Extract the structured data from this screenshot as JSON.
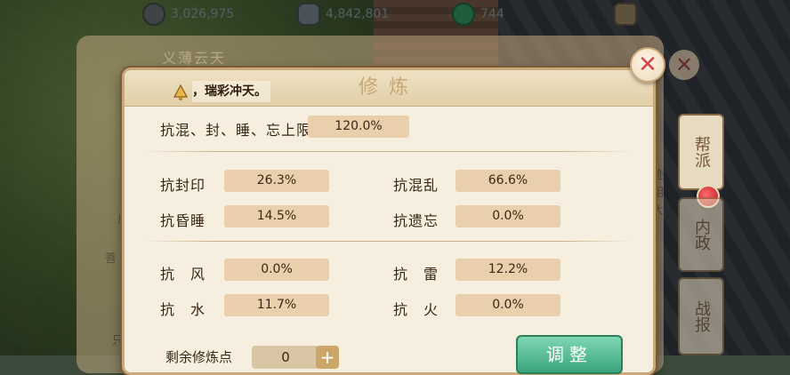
{
  "resources": [
    {
      "icon": "silver-coin-icon",
      "value": "3,026,975"
    },
    {
      "icon": "ingot-icon",
      "value": "4,842,801"
    },
    {
      "icon": "jade-coin-icon",
      "value": "744"
    },
    {
      "icon": "bag-icon",
      "value": ""
    }
  ],
  "background": {
    "panel_title": "义薄云天",
    "side_texts": [
      "庙",
      "菩",
      "只",
      "迹",
      "相",
      "大"
    ]
  },
  "tabs": {
    "help": "帮派",
    "inner": "内政",
    "report": "战报"
  },
  "dialog": {
    "title": "修炼",
    "notice": "，瑞彩冲天。",
    "summary": {
      "label": "抗混、封、睡、忘上限",
      "value": "120.0%"
    },
    "group1": [
      {
        "label": "抗封印",
        "value": "26.3%"
      },
      {
        "label": "抗混乱",
        "value": "66.6%"
      },
      {
        "label": "抗昏睡",
        "value": "14.5%"
      },
      {
        "label": "抗遗忘",
        "value": "0.0%"
      }
    ],
    "group2": [
      {
        "label": "抗　风",
        "value": "0.0%"
      },
      {
        "label": "抗　雷",
        "value": "12.2%"
      },
      {
        "label": "抗　水",
        "value": "11.7%"
      },
      {
        "label": "抗　火",
        "value": "0.0%"
      }
    ],
    "points": {
      "label": "剩余修炼点",
      "value": "0",
      "plus": "+"
    },
    "adjust_label": "调整",
    "close_symbol": "✕"
  },
  "colors": {
    "accent_close": "#d64545",
    "value_box": "#e9cfab",
    "adjust_button": "#3aa67d"
  }
}
